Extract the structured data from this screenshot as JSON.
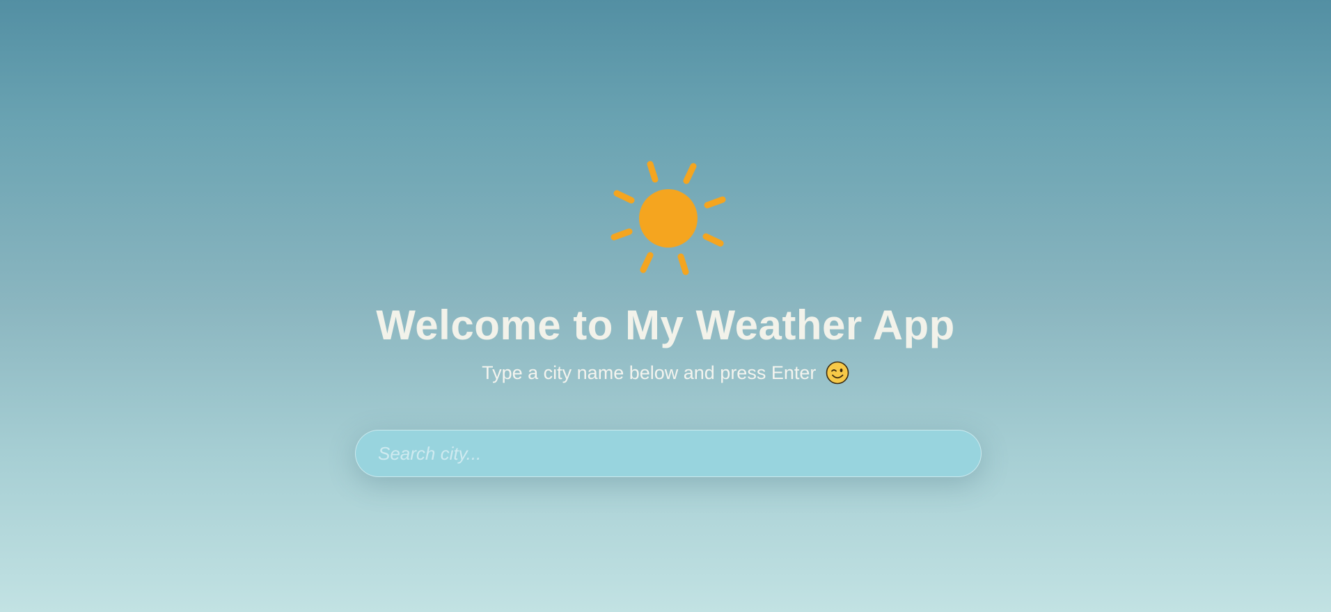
{
  "colors": {
    "sun": "#f5a51f",
    "title_text": "#f2f2ea",
    "search_background": "#98d4de",
    "background_top": "#538fa3",
    "background_bottom": "#c2e2e3"
  },
  "hero": {
    "icon": "sun-icon",
    "title": "Welcome to My Weather App",
    "subtitle": "Type a city name below and press Enter",
    "subtitle_emoji": "winking-face-emoji"
  },
  "search": {
    "placeholder": "Search city...",
    "value": ""
  }
}
